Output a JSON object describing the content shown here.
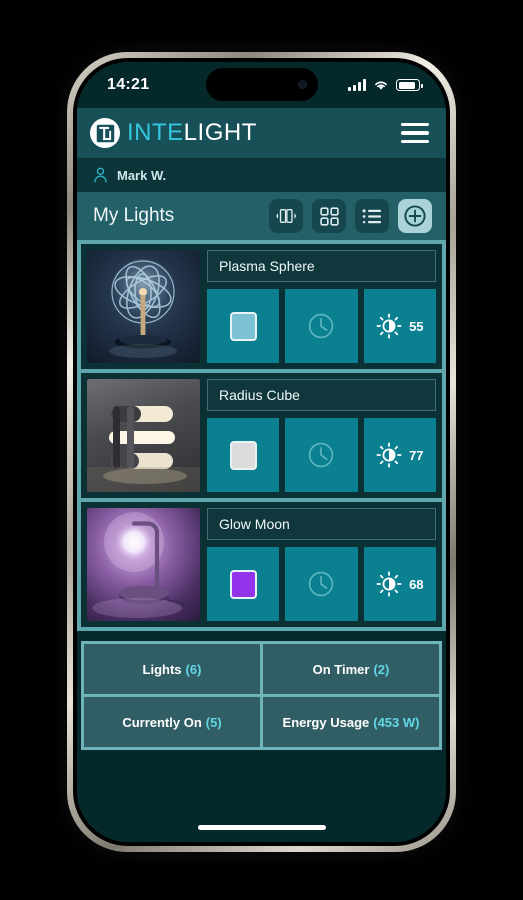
{
  "status_bar": {
    "time": "14:21",
    "signal_icon": "cellular-signal-icon",
    "wifi_icon": "wifi-icon",
    "battery_icon": "battery-icon"
  },
  "header": {
    "logo_monogram": "IL",
    "brand_first": "INTE",
    "brand_second": "LIGHT",
    "brand_accent_color": "#35c6e0",
    "menu_icon": "hamburger-menu-icon"
  },
  "user": {
    "avatar_icon": "person-icon",
    "name": "Mark W."
  },
  "section": {
    "title": "My Lights",
    "tools": [
      {
        "name": "carousel-view-button",
        "icon": "carousel-view-icon",
        "active": false
      },
      {
        "name": "grid-view-button",
        "icon": "grid-view-icon",
        "active": false
      },
      {
        "name": "list-view-button",
        "icon": "list-view-icon",
        "active": false
      },
      {
        "name": "add-light-button",
        "icon": "plus-circle-icon",
        "active": true
      }
    ]
  },
  "lights": [
    {
      "name": "Plasma Sphere",
      "thumb_alt": "plasma-sphere-lamp-photo",
      "color": "#7cc2d4",
      "timer_icon": "clock-icon",
      "brightness_icon": "brightness-sun-icon",
      "brightness": "55"
    },
    {
      "name": "Radius Cube",
      "thumb_alt": "radius-cube-lamp-photo",
      "color": "#dcdcdc",
      "timer_icon": "clock-icon",
      "brightness_icon": "brightness-sun-icon",
      "brightness": "77"
    },
    {
      "name": "Glow Moon",
      "thumb_alt": "glow-moon-lamp-photo",
      "color": "#9333ea",
      "timer_icon": "clock-icon",
      "brightness_icon": "brightness-sun-icon",
      "brightness": "68"
    }
  ],
  "stats": [
    {
      "label": "Lights",
      "value": "(6)"
    },
    {
      "label": "On Timer",
      "value": "(2)"
    },
    {
      "label": "Currently On",
      "value": "(5)"
    },
    {
      "label": "Energy Usage",
      "value": "(453 W)"
    }
  ]
}
